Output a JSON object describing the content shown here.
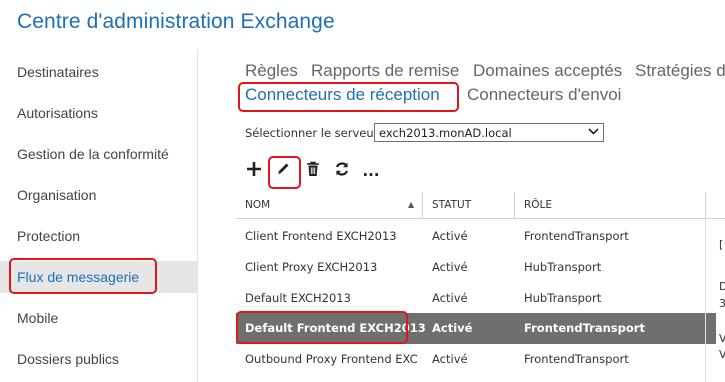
{
  "app": {
    "title": "Centre d'administration Exchange"
  },
  "sidebar": {
    "items": [
      {
        "label": "Destinataires"
      },
      {
        "label": "Autorisations"
      },
      {
        "label": "Gestion de la conformité"
      },
      {
        "label": "Organisation"
      },
      {
        "label": "Protection"
      },
      {
        "label": "Flux de messagerie",
        "selected": true
      },
      {
        "label": "Mobile"
      },
      {
        "label": "Dossiers publics"
      }
    ]
  },
  "tabs": {
    "row1": [
      "Règles",
      "Rapports de remise",
      "Domaines acceptés",
      "Stratégies d'"
    ],
    "row2": [
      "Connecteurs de réception",
      "Connecteurs d'envoi"
    ],
    "active": "Connecteurs de réception"
  },
  "server": {
    "label": "Sélectionner le serveur :",
    "value": "exch2013.monAD.local"
  },
  "toolbar": {
    "icons": [
      "add-icon",
      "edit-icon",
      "delete-icon",
      "refresh-icon",
      "more-icon"
    ],
    "more_label": "..."
  },
  "table": {
    "headers": {
      "name": "NOM",
      "status": "STATUT",
      "role": "RÔLE"
    },
    "sort_indicator": "▲",
    "rows": [
      {
        "name": "Client Frontend EXCH2013",
        "status": "Activé",
        "role": "FrontendTransport"
      },
      {
        "name": "Client Proxy EXCH2013",
        "status": "Activé",
        "role": "HubTransport"
      },
      {
        "name": "Default EXCH2013",
        "status": "Activé",
        "role": "HubTransport"
      },
      {
        "name": "Default Frontend EXCH2013",
        "status": "Activé",
        "role": "FrontendTransport",
        "selected": true
      },
      {
        "name": "Outbound Proxy Frontend EXC...",
        "status": "Activé",
        "role": "FrontendTransport"
      }
    ]
  },
  "details_fragments": [
    "[",
    "D",
    "3",
    "V",
    "V"
  ],
  "colors": {
    "accent": "#1e6fb3",
    "highlight": "#e2151b",
    "selected_row": "#6f6f6f"
  }
}
